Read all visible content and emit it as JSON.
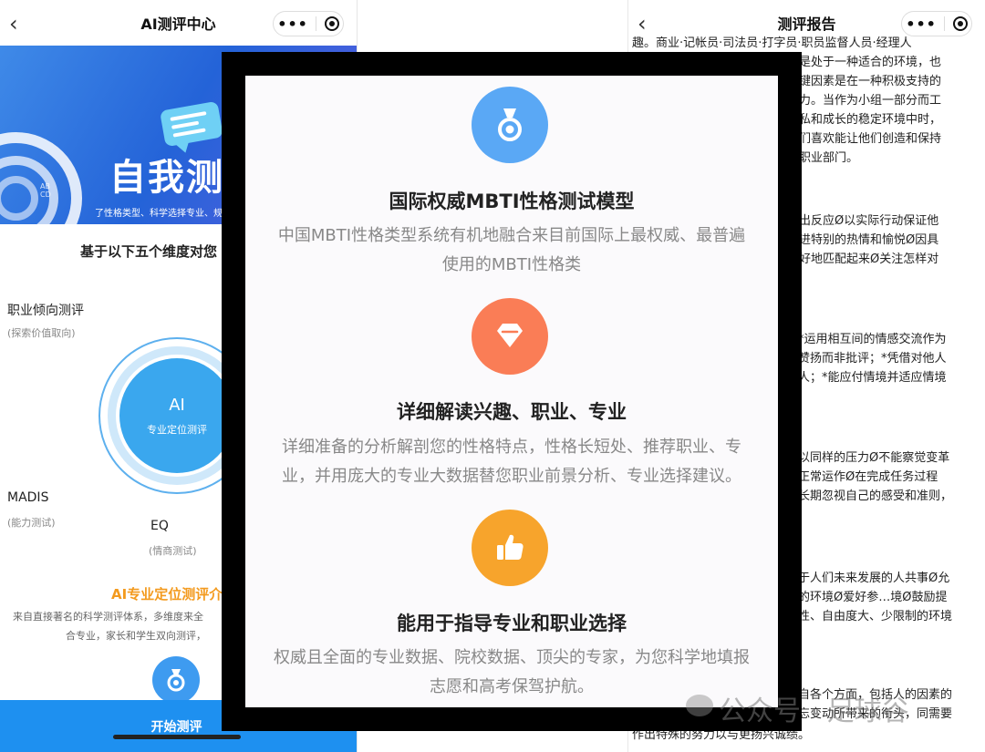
{
  "left_screen": {
    "nav_title": "AI测评中心",
    "banner_title": "自我测评",
    "banner_subtitle": "了性格类型、科学选择专业、规",
    "banner_letters": "ABCD",
    "dimensions_heading": "基于以下五个维度对您",
    "dimensions": [
      {
        "label": "职业倾向测评",
        "sub": "(探索价值取向)"
      },
      {
        "label": "MADIS",
        "sub": "(能力测试)"
      },
      {
        "label": "EQ",
        "sub": "(情商测试)"
      }
    ],
    "center_circle": {
      "title": "AI",
      "subtitle": "专业定位测评"
    },
    "intro_title": "AI专业定位测评介",
    "intro_line1": "来自直接著名的科学测评体系，多维度来全",
    "intro_line2": "合专业，家长和学生双向测评，",
    "start_button": "开始测评"
  },
  "right_screen": {
    "nav_title": "测评报告",
    "lines": [
      "趣。商业·记帐员·司法员·打字员·职员监督人员·经理人",
      "果是处于一种适合的环境，也",
      "关键因素是在一种积极支持的",
      "能力。当作为小组一部分而工",
      "隐私和成长的稳定环境中时，",
      "他们喜欢能让他们创造和保持",
      "的职业部门。",
      "做出反应Ø以实际行动保证他",
      "设进特别的热情和愉悦Ø因具",
      "很好地匹配起来Ø关注怎样对",
      "*运用相互间的情感交流作为",
      "赞扬而非批评；*凭借对他人",
      "人；*能应付情境并适应情境",
      "以同样的压力Ø不能察觉变革",
      "正常运作Ø在完成任务过程",
      "长期忽视自己的感受和准则，",
      "于人们未来发展的人共事Ø允",
      "的环境Ø爱好参…境Ø鼓励提",
      "性、自由度大、少限制的环境",
      "自各个方面，包括人的因素的",
      "忘变动所带来的衔头，同需要",
      "作出特殊的努力以与更扬兴诚绩。"
    ]
  },
  "modal": {
    "features": [
      {
        "icon": "medal-icon",
        "color": "#5aa8f5",
        "title": "国际权威MBTI性格测试模型",
        "desc_line1": "中国MBTI性格类型系统有机地融合来目前国际上最权威、最普遍",
        "desc_line2": "使用的MBTI性格类"
      },
      {
        "icon": "diamond-icon",
        "color": "#fa7d56",
        "title": "详细解读兴趣、职业、专业",
        "desc_line1": "详细准备的分析解剖您的性格特点，性格长短处、推荐职业、专",
        "desc_line2": "业，并用庞大的专业大数据替您职业前景分析、专业选择建议。"
      },
      {
        "icon": "thumbs-up-icon",
        "color": "#f7a42c",
        "title": "能用于指导专业和职业选择",
        "desc_line1": "权威且全面的专业数据、院校数据、顶尖的专家，为您科学地填报",
        "desc_line2": "志愿和高考保驾护航。"
      }
    ]
  },
  "watermark": "公众号 · 足球谷"
}
